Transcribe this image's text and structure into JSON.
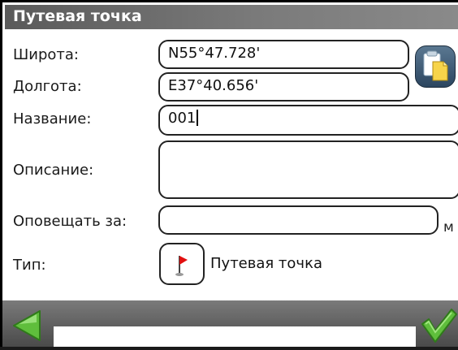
{
  "window": {
    "title": "Путевая точка"
  },
  "form": {
    "latitude": {
      "label": "Широта:",
      "value": "N55°47.728'"
    },
    "longitude": {
      "label": "Долгота:",
      "value": "E37°40.656'"
    },
    "name": {
      "label": "Название:",
      "value": "001"
    },
    "description": {
      "label": "Описание:",
      "value": ""
    },
    "alert": {
      "label": "Оповещать за:",
      "value": "",
      "unit": "м"
    },
    "type": {
      "label": "Тип:",
      "value": "Путевая точка",
      "icon": "red-flag-icon"
    }
  },
  "buttons": {
    "paste": {
      "icon": "paste-icon"
    },
    "back": {
      "icon": "back-arrow-icon"
    },
    "confirm": {
      "icon": "checkmark-icon"
    }
  },
  "colors": {
    "title_bar": "#6a6a6a",
    "back_arrow": "#5fbe3c",
    "checkmark": "#5fbe3c",
    "flag": "#e01010",
    "paste_button": "#3a5670"
  }
}
